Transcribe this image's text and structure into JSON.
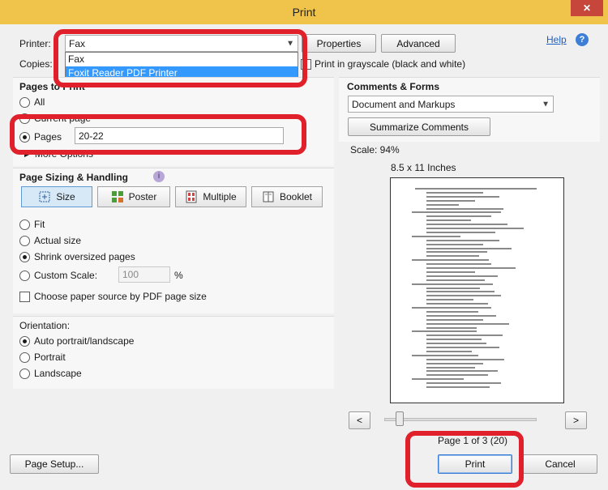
{
  "window": {
    "title": "Print",
    "close_icon": "close-icon"
  },
  "printer": {
    "label": "Printer:",
    "selected": "Fax",
    "options": [
      "Fax",
      "Foxit Reader PDF Printer"
    ],
    "properties_label": "Properties",
    "advanced_label": "Advanced",
    "help_label": "Help"
  },
  "copies": {
    "label": "Copies:"
  },
  "grayscale": {
    "label": "Print in grayscale (black and white)"
  },
  "pages_to_print": {
    "title": "Pages to Print",
    "all": "All",
    "current": "Current page",
    "pages": "Pages",
    "pages_value": "20-22",
    "more_options": "More Options"
  },
  "sizing": {
    "title": "Page Sizing & Handling",
    "buttons": [
      "Size",
      "Poster",
      "Multiple",
      "Booklet"
    ],
    "fit": "Fit",
    "actual": "Actual size",
    "shrink": "Shrink oversized pages",
    "custom": "Custom Scale:",
    "custom_value": "100",
    "percent": "%",
    "paper_source": "Choose paper source by PDF page size"
  },
  "orientation": {
    "title": "Orientation:",
    "auto": "Auto portrait/landscape",
    "portrait": "Portrait",
    "landscape": "Landscape"
  },
  "comments": {
    "title": "Comments & Forms",
    "selected": "Document and Markups",
    "summarize_label": "Summarize Comments"
  },
  "preview": {
    "scale": "Scale:  94%",
    "paper": "8.5 x 11 Inches",
    "prev": "<",
    "next": ">",
    "page_indicator": "Page 1 of 3 (20)"
  },
  "footer": {
    "page_setup": "Page Setup...",
    "print": "Print",
    "cancel": "Cancel"
  },
  "colors": {
    "titlebar": "#f0c44a",
    "highlight": "#e0202a",
    "accent": "#3399ff"
  }
}
